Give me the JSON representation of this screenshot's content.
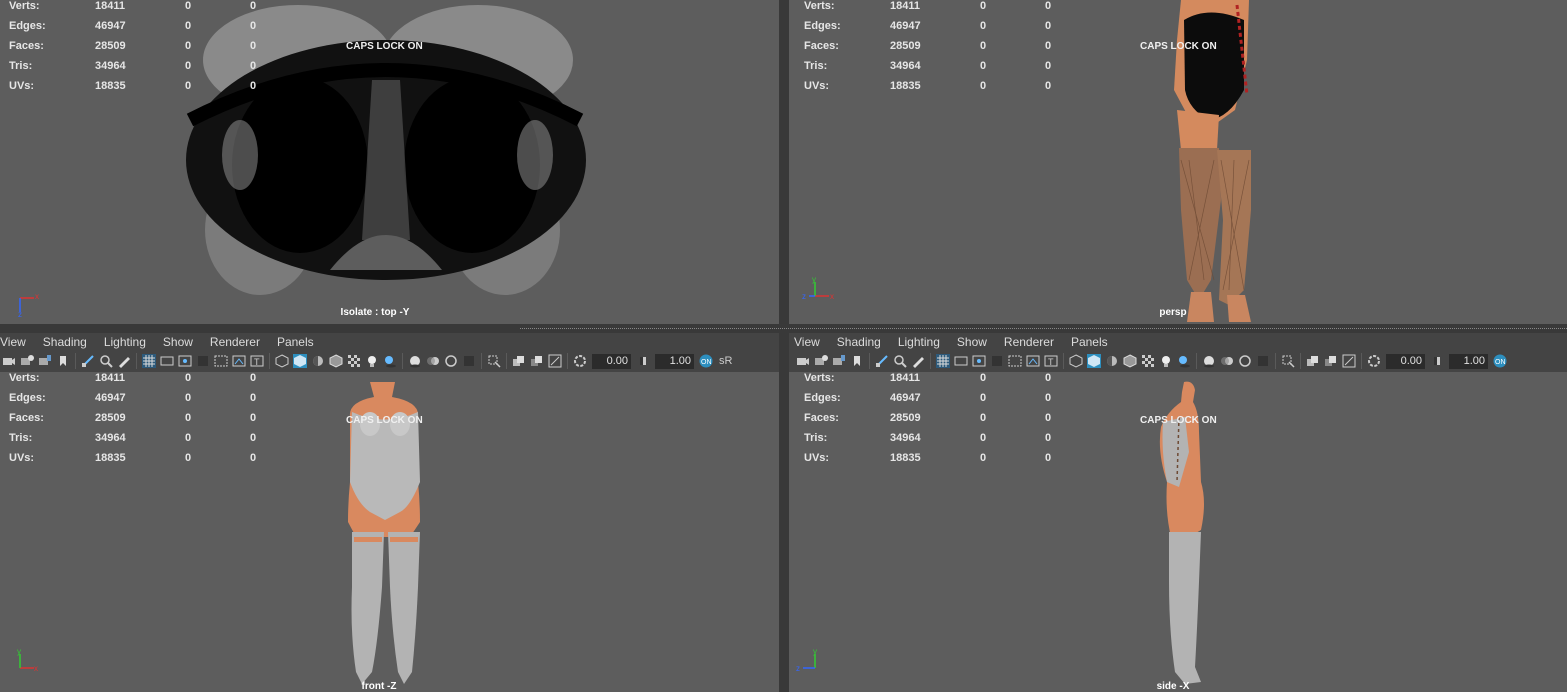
{
  "stats": [
    {
      "label": "Verts:",
      "a": "18411",
      "b": "0",
      "c": "0"
    },
    {
      "label": "Edges:",
      "a": "46947",
      "b": "0",
      "c": "0"
    },
    {
      "label": "Faces:",
      "a": "28509",
      "b": "0",
      "c": "0"
    },
    {
      "label": "Tris:",
      "a": "34964",
      "b": "0",
      "c": "0"
    },
    {
      "label": "UVs:",
      "a": "18835",
      "b": "0",
      "c": "0"
    }
  ],
  "caps_lock": "CAPS LOCK ON",
  "viewports": {
    "top_left": {
      "camera": "Isolate : top -Y"
    },
    "top_right": {
      "camera": "persp"
    },
    "bottom_left": {
      "camera": "front -Z"
    },
    "bottom_right": {
      "camera": "side -X"
    }
  },
  "menu": [
    "View",
    "Shading",
    "Lighting",
    "Show",
    "Renderer",
    "Panels"
  ],
  "toolbar": {
    "exposure": "0.00",
    "gamma": "1.00",
    "colorspace": "sR"
  },
  "axes": {
    "x": "x",
    "y": "y",
    "z": "z"
  },
  "colors": {
    "viewport": "#5d5d5d",
    "panel": "#444444",
    "skin": "#d9895f",
    "highlight": "#2d8fbf"
  }
}
